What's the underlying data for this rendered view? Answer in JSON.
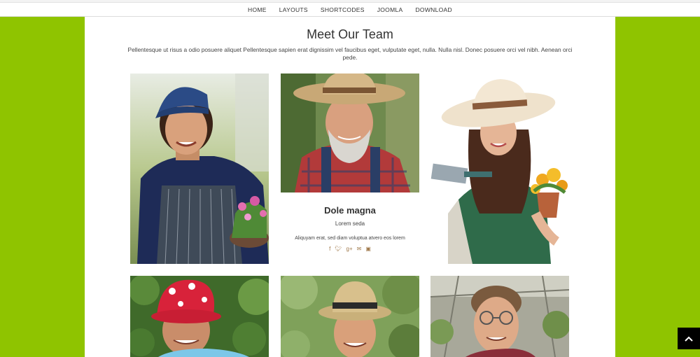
{
  "nav": {
    "items": [
      "HOME",
      "LAYOUTS",
      "SHORTCODES",
      "JOOMLA",
      "DOWNLOAD"
    ]
  },
  "section": {
    "title": "Meet Our Team",
    "intro": "Pellentesque ut risus a odio posuere aliquet Pellentesque sapien erat dignissim vel faucibus eget, vulputate eget, nulla. Nulla nisl. Donec posuere orci vel nibh. Aenean orci pede."
  },
  "featured_member": {
    "name": "Dole magna",
    "role": "Lorem seda",
    "bio": "Aliquyam erat, sed diam voluptua atvero eos lorem",
    "social_icons": [
      "facebook-icon",
      "twitter-icon",
      "google-plus-icon",
      "envelope-icon",
      "instagram-icon"
    ]
  },
  "colors": {
    "page_background": "#8fc400",
    "accent_icons": "#a07a4c",
    "back_to_top": "#000000"
  }
}
